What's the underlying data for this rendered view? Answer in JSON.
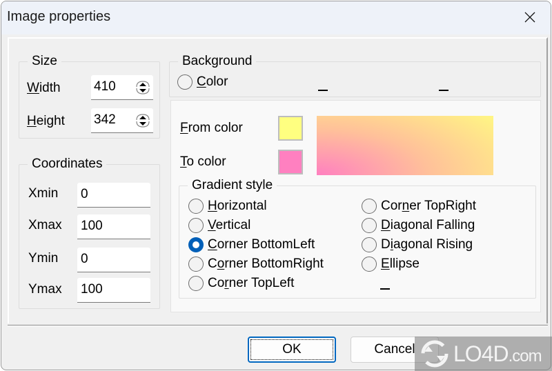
{
  "window": {
    "title": "Image properties",
    "close_icon": "close-icon"
  },
  "size_group": {
    "legend": "Size",
    "width_label_u": "W",
    "width_label_rest": "idth",
    "width_value": "410",
    "height_label_u": "H",
    "height_label_rest": "eight",
    "height_value": "342"
  },
  "coordinates_group": {
    "legend": "Coordinates",
    "fields": [
      {
        "label": "Xmin",
        "value": "0"
      },
      {
        "label": "Xmax",
        "value": "100"
      },
      {
        "label": "Ymin",
        "value": "0"
      },
      {
        "label": "Ymax",
        "value": "100"
      }
    ]
  },
  "background_group": {
    "legend": "Background",
    "color_option_u": "C",
    "color_option_rest": "olor",
    "color_option_checked": false
  },
  "gradient_panel": {
    "from_color_u": "F",
    "from_color_rest": "rom color",
    "from_color_hex": "#ffff80",
    "to_color_u": "T",
    "to_color_rest": "o color",
    "to_color_hex": "#ff80c0",
    "gradient_style_legend": "Gradient style",
    "selected_style": "Corner BottomLeft",
    "styles_left": [
      {
        "pre": "",
        "u": "H",
        "post": "orizontal",
        "checked": false
      },
      {
        "pre": "",
        "u": "V",
        "post": "ertical",
        "checked": false
      },
      {
        "pre": "",
        "u": "C",
        "post": "orner BottomLeft",
        "checked": true
      },
      {
        "pre": "C",
        "u": "o",
        "post": "rner BottomRight",
        "checked": false
      },
      {
        "pre": "Co",
        "u": "r",
        "post": "ner TopLeft",
        "checked": false
      }
    ],
    "styles_right": [
      {
        "pre": "Cor",
        "u": "n",
        "post": "er TopRight",
        "checked": false
      },
      {
        "pre": "",
        "u": "D",
        "post": "iagonal Falling",
        "checked": false
      },
      {
        "pre": "D",
        "u": "i",
        "post": "agonal Rising",
        "checked": false
      },
      {
        "pre": "",
        "u": "E",
        "post": "llipse",
        "checked": false
      }
    ]
  },
  "buttons": {
    "ok": "OK",
    "cancel": "Cancel"
  },
  "watermark": {
    "text": "LO4D",
    "suffix": ".com"
  }
}
